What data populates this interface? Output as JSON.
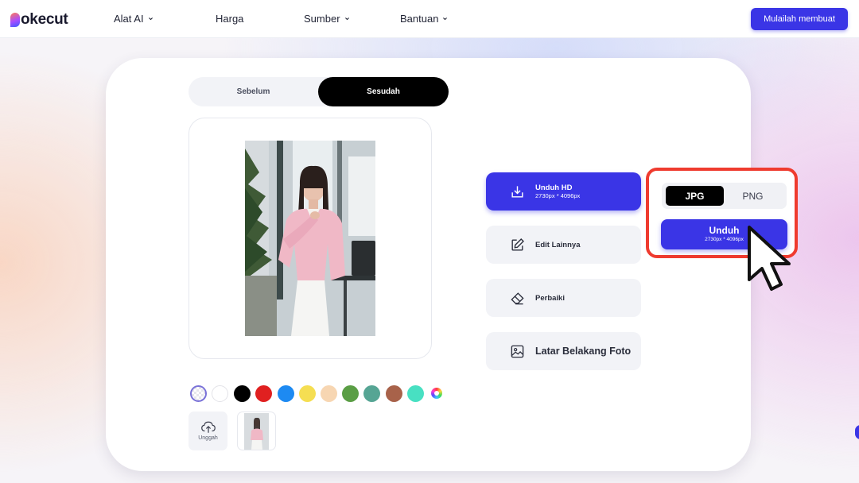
{
  "nav": {
    "logo_text": "okecut",
    "items": [
      {
        "label": "Alat AI",
        "has_dropdown": true
      },
      {
        "label": "Harga",
        "has_dropdown": false
      },
      {
        "label": "Sumber",
        "has_dropdown": true
      },
      {
        "label": "Bantuan",
        "has_dropdown": true
      }
    ],
    "cta_label": "Mulailah membuat"
  },
  "compare_toggle": {
    "before_label": "Sebelum",
    "after_label": "Sesudah",
    "selected": "Sesudah"
  },
  "swatches": [
    {
      "name": "transparent",
      "color": "transparent",
      "selected": true
    },
    {
      "name": "white",
      "color": "#ffffff"
    },
    {
      "name": "black",
      "color": "#000000"
    },
    {
      "name": "red",
      "color": "#e02020"
    },
    {
      "name": "blue",
      "color": "#1d8af2"
    },
    {
      "name": "yellow",
      "color": "#f5de52"
    },
    {
      "name": "peach",
      "color": "#f7d6b2"
    },
    {
      "name": "green",
      "color": "#5a9e45"
    },
    {
      "name": "teal",
      "color": "#56a594"
    },
    {
      "name": "brown",
      "color": "#a8624a"
    },
    {
      "name": "aqua",
      "color": "#48e0c2"
    },
    {
      "name": "custom",
      "color": "color-wheel-icon"
    }
  ],
  "upload": {
    "label": "Unggah"
  },
  "actions": {
    "download_hd": {
      "title": "Unduh HD",
      "subtitle": "2730px * 4096px"
    },
    "edit_more": {
      "label": "Edit Lainnya"
    },
    "repair": {
      "label": "Perbaiki"
    },
    "background": {
      "label": "Latar Belakang Foto"
    }
  },
  "download_popup": {
    "formats": [
      "JPG",
      "PNG"
    ],
    "selected_format": "JPG",
    "button_title": "Unduh",
    "button_subtitle": "2730px * 4096px"
  },
  "colors": {
    "accent": "#3a35e6",
    "highlight": "#ef3b2f",
    "dark_toggle": "#000000"
  }
}
